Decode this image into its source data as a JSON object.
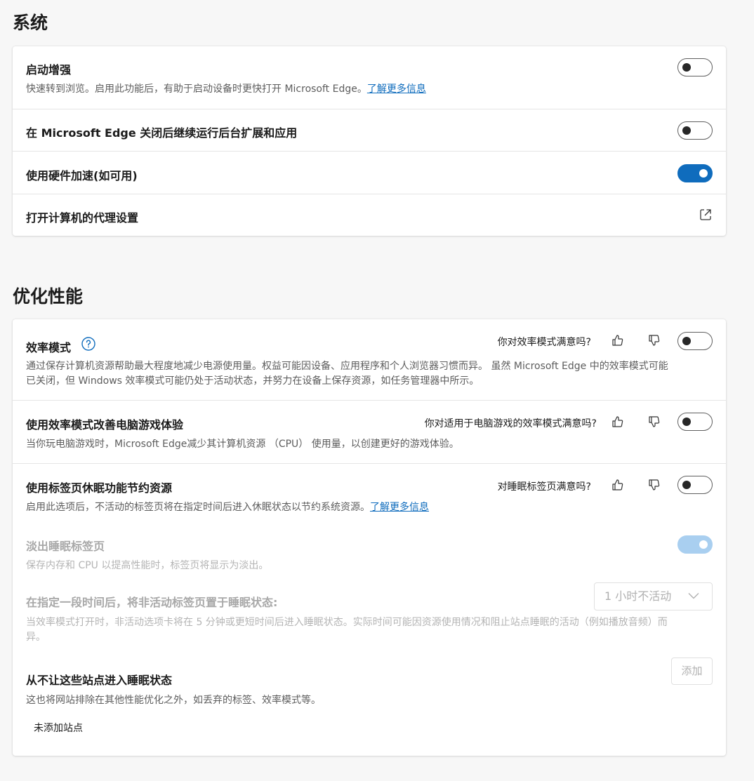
{
  "system": {
    "heading": "系统",
    "startup_boost": {
      "title": "启动增强",
      "desc": "快速转到浏览。启用此功能后，有助于启动设备时更快打开 Microsoft Edge。",
      "link": "了解更多信息",
      "enabled": false
    },
    "background_run": {
      "title": "在 Microsoft Edge 关闭后继续运行后台扩展和应用",
      "enabled": false
    },
    "hardware_accel": {
      "title": "使用硬件加速(如可用)",
      "enabled": true
    },
    "proxy": {
      "title": "打开计算机的代理设置"
    }
  },
  "performance": {
    "heading": "优化性能",
    "efficiency_mode": {
      "title": "效率模式",
      "feedback": "你对效率模式满意吗?",
      "desc_line1": "通过保存计算机资源帮助最大程度地减少电源使用量。权益可能因设备、应用程序和个人浏览器习惯而异。 虽然 Microsoft Edge 中的效率模式可能",
      "desc_line2": "已关闭，但 Windows 效率模式可能仍处于活动状态，并努力在设备上保存资源，如任务管理器中所示。",
      "enabled": false
    },
    "gaming": {
      "title": "使用效率模式改善电脑游戏体验",
      "feedback": "你对适用于电脑游戏的效率模式满意吗?",
      "desc": "当你玩电脑游戏时，Microsoft Edge减少其计算机资源 （CPU） 使用量，以创建更好的游戏体验。",
      "enabled": false
    },
    "sleeping_tabs": {
      "title": "使用标签页休眠功能节约资源",
      "feedback": "对睡眠标签页满意吗?",
      "desc": "启用此选项后，不活动的标签页将在指定时间后进入休眠状态以节约系统资源。",
      "link": "了解更多信息",
      "enabled": false
    },
    "fade_sleeping": {
      "title": "淡出睡眠标签页",
      "desc": "保存内存和 CPU 以提高性能时，标签页将显示为淡出。",
      "enabled": true
    },
    "sleep_after": {
      "title": "在指定一段时间后，将非活动标签页置于睡眠状态:",
      "selected": "1 小时不活动",
      "desc_line1": "当效率模式打开时，非活动选项卡将在 5 分钟或更短时间后进入睡眠状态。实际时间可能因资源使用情况和阻止站点睡眠的活动（例如播放音频）而",
      "desc_line2": "异。"
    },
    "never_sleep": {
      "title": "从不让这些站点进入睡眠状态",
      "desc": "这也将网站排除在其他性能优化之外，如丢弃的标签、效率模式等。",
      "add_label": "添加",
      "empty": "未添加站点"
    }
  },
  "colors": {
    "accent": "#0f6cbd",
    "accent_disabled": "#a9cff0",
    "background": "#f7f7f7"
  }
}
